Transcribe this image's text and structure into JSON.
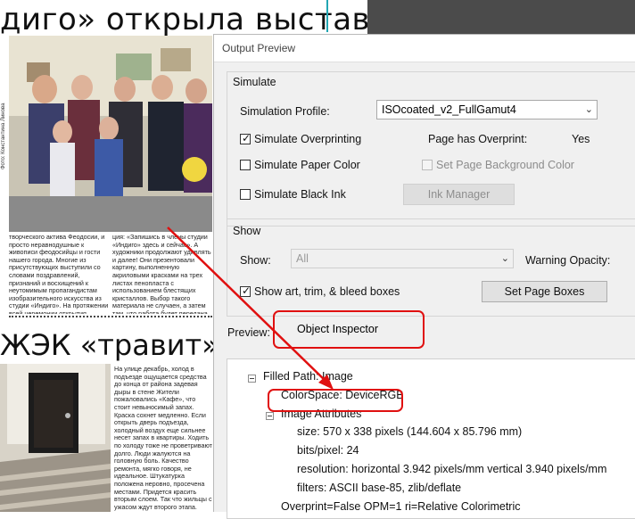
{
  "newspaper": {
    "headline_top": "дигo» открыла выставку",
    "headline_bottom": "ЖЭК «травит» жил",
    "photo_credit": "Фото: Константина Линова",
    "column_left": "творческого актива Феодосии, и просто неравнодушные к живописи феодосийцы и гости нашего города. Многие из присутствующих выступили со словами поздравлений, признаний и восхищений к неутомимым пропагандистам изобразительного искусства из студии «Индиго». На протяжении всей церемонии открытия выставки также действовала ак-",
    "column_right": "ция: «Запишись в члены студии «Индиго» здесь и сейчас». А художники продолжают удивлять и далее! Они презентовали картину, выполненную акриловыми красками на трех листах пенопласта с использованием блестящих кристаллов. Выбор такого материала не случаен, а затем там, что работа будет передана друзьям «Индиго».",
    "column_article": "На улице декабрь, холод в подъезде ощущается средства до конца от района задевая дыры в стене Жители пожаловались «Кафе», что стоит невыносимый запах. Краска сохнет медленно. Если открыть дверь подъезда, холодный воздух еще сильнее несет запах в квартиры. Ходить по холоду тоже не проветривают долго. Люди жалуются на головную боль. Качество ремонта, мягко говоря, не идеальное. Штукатурка положена неровно, просечена местами. Придется красить вторым слоем. Так что жильцы с ужасом ждут второго этапа."
  },
  "dialog": {
    "title": "Output Preview",
    "simulate": {
      "section_label": "Simulate",
      "profile_label": "Simulation Profile:",
      "profile_value": "ISOcoated_v2_FullGamut4",
      "overprinting_label": "Simulate Overprinting",
      "overprint_status_label": "Page has Overprint:",
      "overprint_status_value": "Yes",
      "paper_color_label": "Simulate Paper Color",
      "page_bg_label": "Set Page Background Color",
      "black_ink_label": "Simulate Black Ink",
      "ink_manager_label": "Ink Manager"
    },
    "show": {
      "section_label": "Show",
      "show_label": "Show:",
      "show_value": "All",
      "warning_label": "Warning Opacity:",
      "bleed_label": "Show art, trim, & bleed boxes",
      "page_boxes_label": "Set Page Boxes"
    },
    "preview": {
      "label": "Preview:",
      "value": "Object Inspector"
    },
    "inspector": {
      "filled_path": "Filled Path: Image",
      "colorspace": "ColorSpace: DeviceRGB",
      "image_attributes": "Image Attributes",
      "size": "size: 570 x 338 pixels (144.604 x 85.796 mm)",
      "bits": "bits/pixel: 24",
      "resolution": "resolution: horizontal 3.942 pixels/mm vertical 3.940 pixels/mm",
      "filters": "filters: ASCII base-85, zlib/deflate",
      "overprint": "Overprint=False OPM=1 ri=Relative Colorimetric"
    }
  },
  "colors": {
    "annotation_red": "#e01010",
    "accent_cyan": "#22a6b3",
    "dialog_bg": "#f0f0f0"
  }
}
